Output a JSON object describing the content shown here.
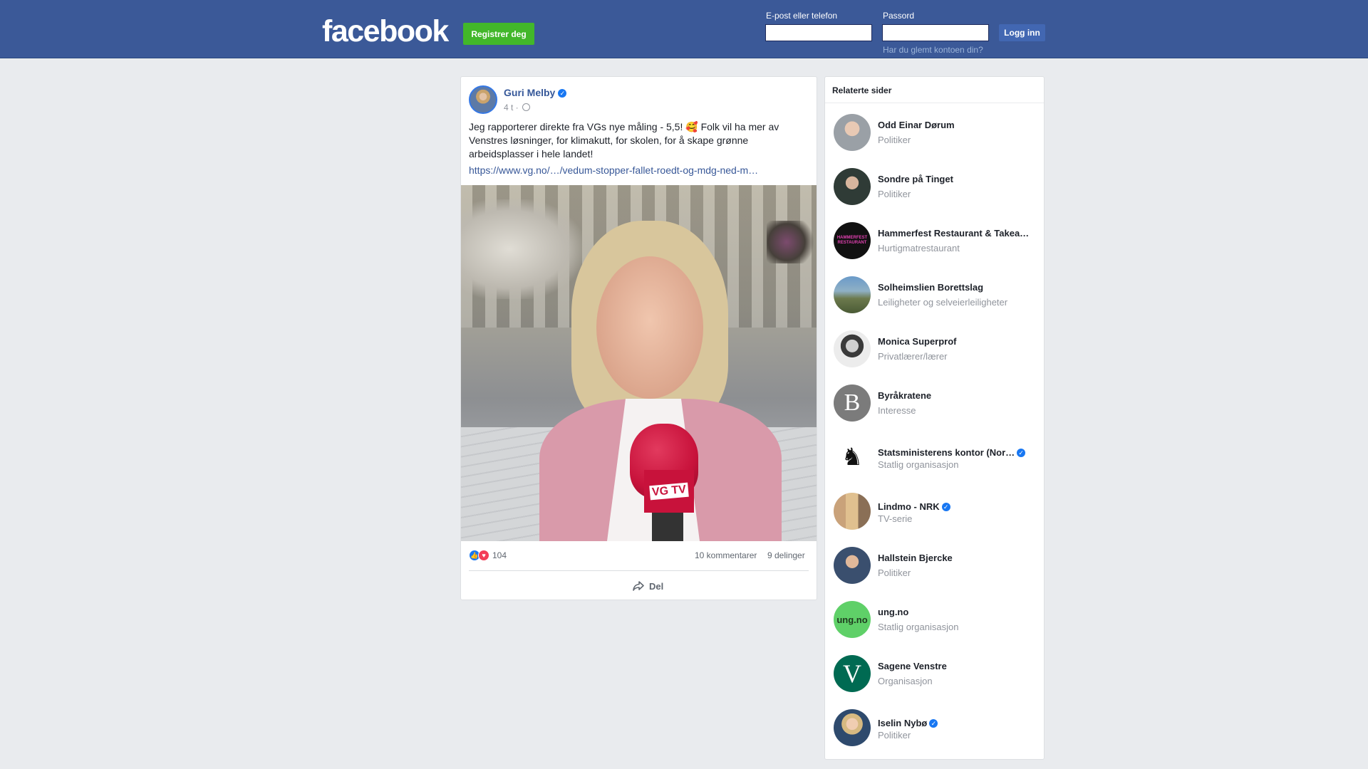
{
  "header": {
    "logo": "facebook",
    "register_label": "Registrer deg",
    "email_label": "E-post eller telefon",
    "password_label": "Passord",
    "login_label": "Logg inn",
    "forgot_label": "Har du glemt kontoen din?"
  },
  "post": {
    "author": "Guri Melby",
    "time": "4 t",
    "text": "Jeg rapporterer direkte fra VGs nye måling - 5,5! 🥰 Folk vil ha mer av Venstres løsninger, for klimakutt, for skolen, for å skape grønne arbeidsplasser i hele landet!",
    "link": "https://www.vg.no/…/vedum-stopper-fallet-roedt-og-mdg-ned-m…",
    "mic_text": "VG TV",
    "reaction_count": "104",
    "comments": "10 kommentarer",
    "shares": "9 delinger",
    "share_label": "Del"
  },
  "related": {
    "title": "Relaterte sider",
    "items": [
      {
        "name": "Odd Einar Dørum",
        "category": "Politiker",
        "verified": false,
        "avatar": "person-gray"
      },
      {
        "name": "Sondre på Tinget",
        "category": "Politiker",
        "verified": false,
        "avatar": "person-dark"
      },
      {
        "name": "Hammerfest Restaurant & Takea…",
        "category": "Hurtigmatrestaurant",
        "verified": false,
        "avatar": "restaurant-logo"
      },
      {
        "name": "Solheimslien Borettslag",
        "category": "Leiligheter og selveierleiligheter",
        "verified": false,
        "avatar": "landscape"
      },
      {
        "name": "Monica Superprof",
        "category": "Privatlærer/lærer",
        "verified": false,
        "avatar": "person-bw"
      },
      {
        "name": "Byråkratene",
        "category": "Interesse",
        "verified": false,
        "avatar": "letter-b"
      },
      {
        "name": "Statsministerens kontor (Nor…",
        "category": "Statlig organisasjon",
        "verified": true,
        "avatar": "lion-crest"
      },
      {
        "name": "Lindmo - NRK",
        "category": "TV-serie",
        "verified": true,
        "avatar": "group-photo"
      },
      {
        "name": "Hallstein Bjercke",
        "category": "Politiker",
        "verified": false,
        "avatar": "person-suit"
      },
      {
        "name": "ung.no",
        "category": "Statlig organisasjon",
        "verified": false,
        "avatar": "ungno-logo"
      },
      {
        "name": "Sagene Venstre",
        "category": "Organisasjon",
        "verified": false,
        "avatar": "venstre-logo"
      },
      {
        "name": "Iselin Nybø",
        "category": "Politiker",
        "verified": true,
        "avatar": "person-blonde"
      }
    ]
  },
  "colors": {
    "topbar": "#3b5998",
    "register": "#42b72a",
    "link": "#385898",
    "background": "#e9ebee"
  }
}
